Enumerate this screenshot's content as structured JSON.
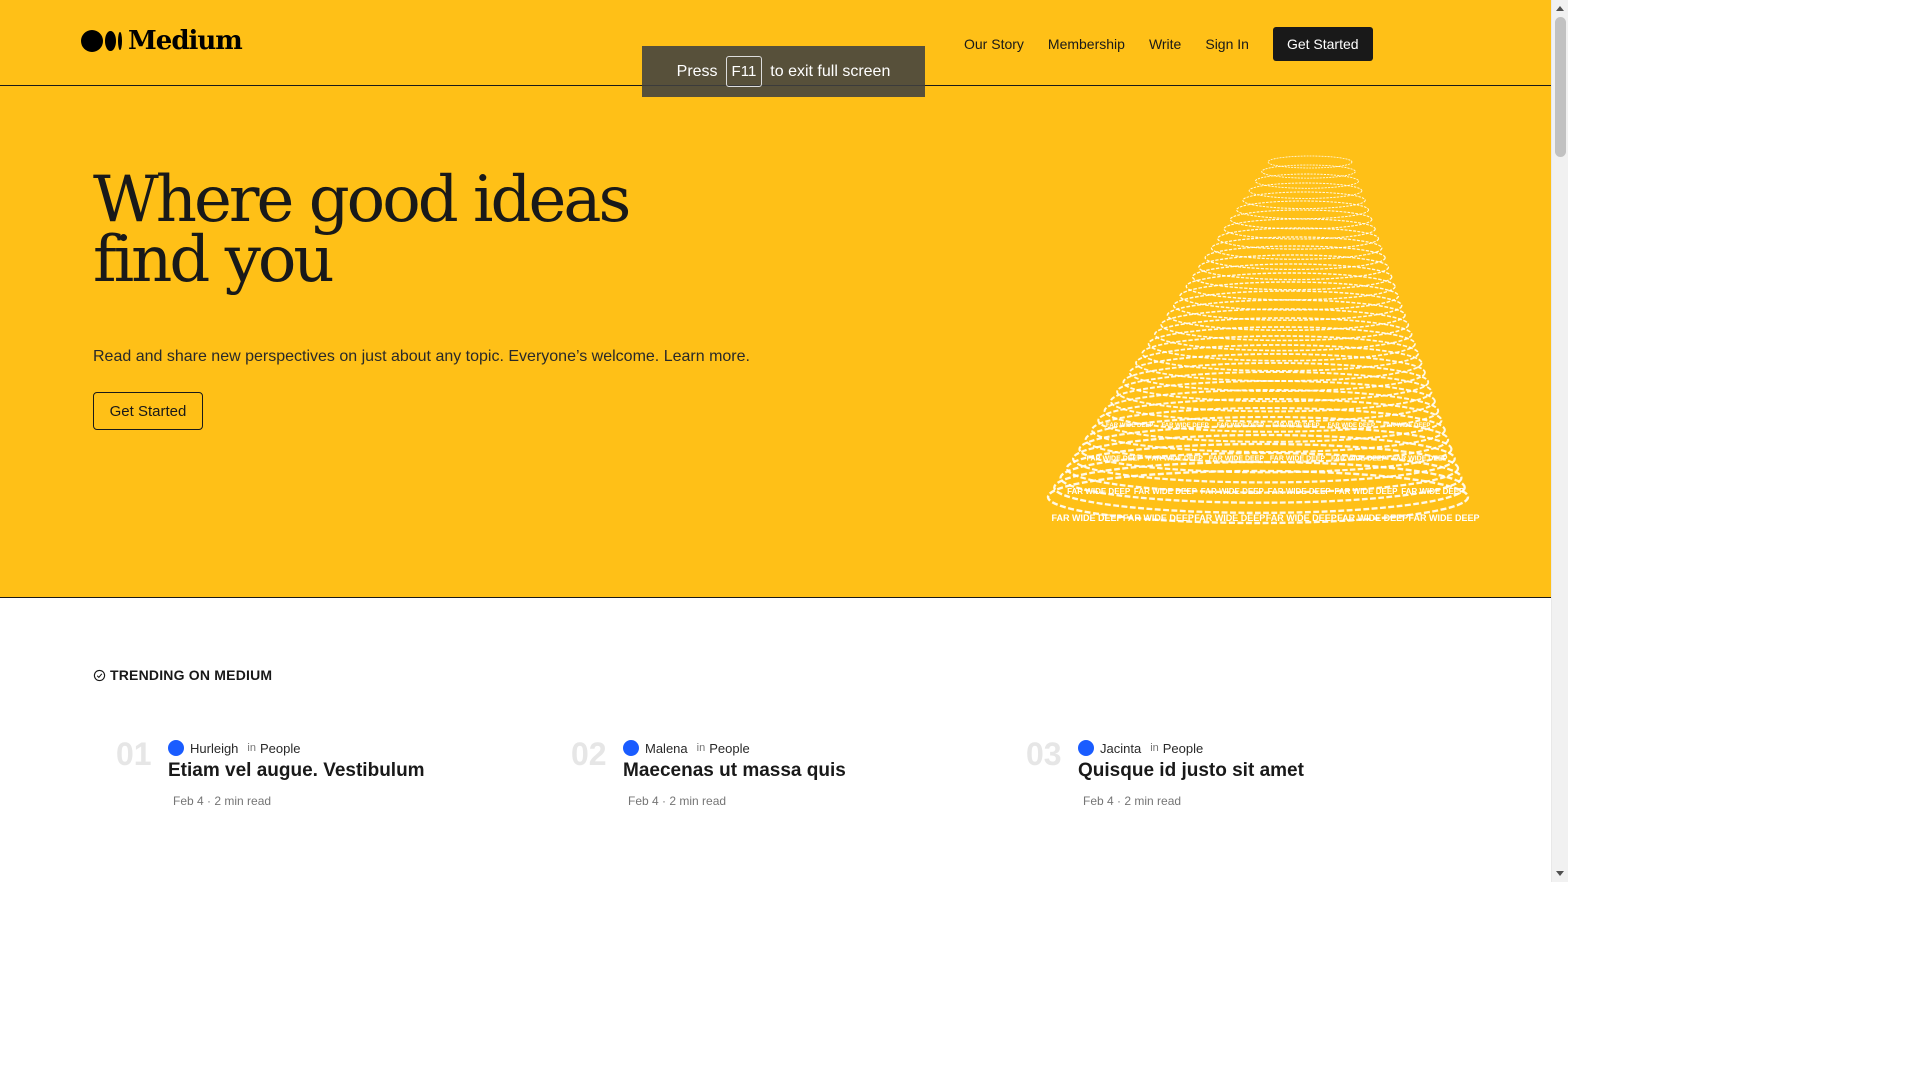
{
  "header": {
    "brand": "Medium",
    "nav": [
      "Our Story",
      "Membership",
      "Write",
      "Sign In"
    ],
    "cta": "Get Started"
  },
  "fullscreen_notice": {
    "prefix": "Press",
    "key": "F11",
    "suffix": "to exit full screen"
  },
  "hero": {
    "headline": "Where good ideas find you",
    "subtext": "Read and share new perspectives on just about any topic. Everyone’s welcome. Learn more.",
    "button": "Get Started",
    "illustration_text": "FAR WIDE DEEP"
  },
  "trending": {
    "heading": "TRENDING ON MEDIUM",
    "items": [
      {
        "num": "01",
        "author": "Hurleigh",
        "in": "in",
        "topic": "People",
        "title": "Etiam vel augue. Vestibulum",
        "date": "Feb 4 · 2 min read"
      },
      {
        "num": "02",
        "author": "Malena",
        "in": "in",
        "topic": "People",
        "title": "Maecenas ut massa quis",
        "date": "Feb 4 · 2 min read"
      },
      {
        "num": "03",
        "author": "Jacinta",
        "in": "in",
        "topic": "People",
        "title": "Quisque id justo sit amet",
        "date": "Feb 4 · 2 min read"
      }
    ]
  },
  "colors": {
    "hero_bg": "#ffc017",
    "text": "#191919",
    "avatar": "#1a5cff",
    "muted": "#757575"
  }
}
